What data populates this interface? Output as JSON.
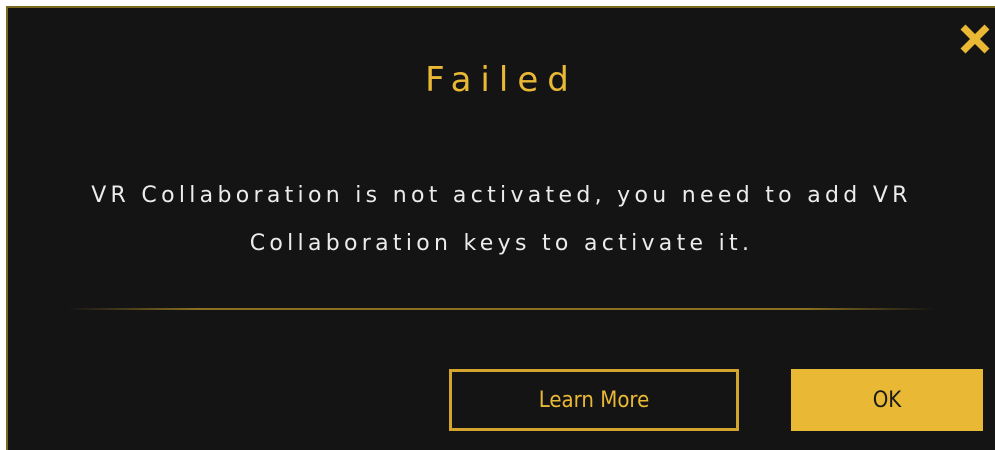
{
  "dialog": {
    "title": "Failed",
    "message": "VR Collaboration is not activated, you need to add VR Collaboration keys to activate it.",
    "close_icon": "close-x-icon",
    "buttons": {
      "learn_more": "Learn More",
      "ok": "OK"
    }
  },
  "colors": {
    "background": "#141414",
    "accent": "#e9b935",
    "text": "#ececec",
    "border": "#7a6a1f"
  }
}
